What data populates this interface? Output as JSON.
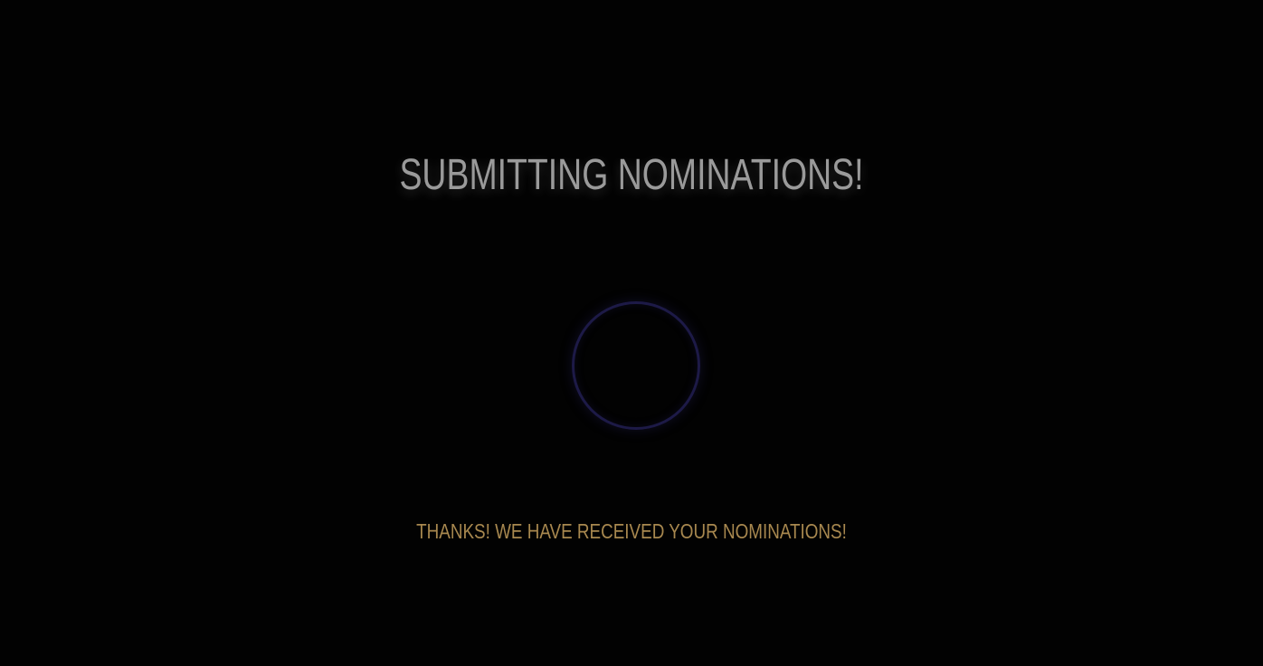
{
  "status": {
    "title": "SUBMITTING NOMINATIONS!",
    "message": "THANKS! WE HAVE RECEIVED YOUR NOMINATIONS!"
  },
  "spinner": {
    "icon": "loading-spinner-icon",
    "color": "#1d1a47"
  },
  "colors": {
    "background": "#020202",
    "title": "#9a9a9a",
    "message": "#a8884f"
  }
}
